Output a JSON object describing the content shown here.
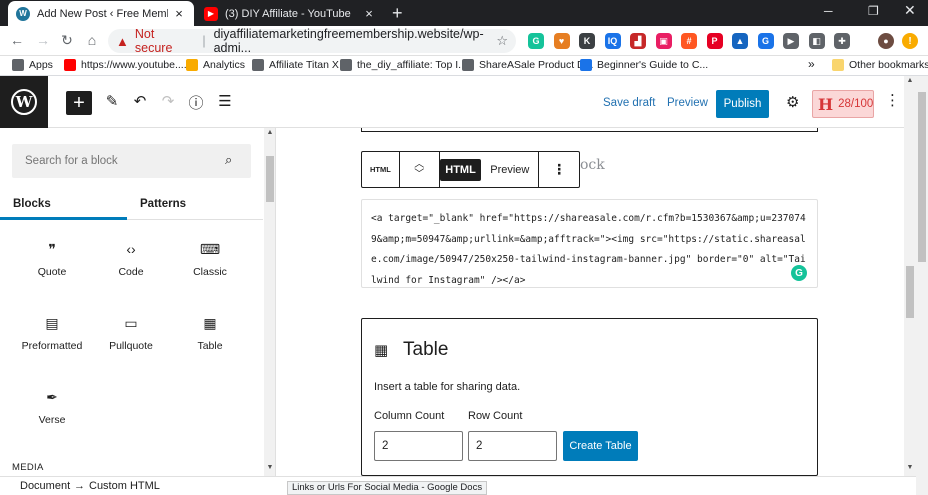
{
  "browser": {
    "tabs": [
      {
        "title": "Add New Post ‹ Free Membership F",
        "active": true
      },
      {
        "title": "(3) DIY Affiliate - YouTube",
        "active": false
      }
    ],
    "security_label": "Not secure",
    "url": "diyaffiliatemarketingfreemembership.website/wp-admi...",
    "extensions": [
      {
        "name": "grammarly-icon",
        "glyph": "G",
        "color": "#15c39a"
      },
      {
        "name": "heart-icon",
        "glyph": "♥",
        "color": "#e67e22"
      },
      {
        "name": "k-extension-icon",
        "glyph": "K",
        "color": "#3c4043"
      },
      {
        "name": "iq-extension-icon",
        "glyph": "IQ",
        "color": "#1a73e8"
      },
      {
        "name": "chart-extension-icon",
        "glyph": "▟",
        "color": "#c62828"
      },
      {
        "name": "photo-extension-icon",
        "glyph": "▣",
        "color": "#e91e63"
      },
      {
        "name": "hashtag-extension-icon",
        "glyph": "#",
        "color": "#ff5722"
      },
      {
        "name": "pinterest-icon",
        "glyph": "P",
        "color": "#e60023"
      },
      {
        "name": "tailwind-icon",
        "glyph": "▲",
        "color": "#1565c0"
      },
      {
        "name": "translate-icon",
        "glyph": "G",
        "color": "#1a73e8"
      },
      {
        "name": "video-extension-icon",
        "glyph": "▶",
        "color": "#5f6368"
      },
      {
        "name": "screenshot-extension-icon",
        "glyph": "◧",
        "color": "#5f6368"
      },
      {
        "name": "puzzle-icon",
        "glyph": "✚",
        "color": "#5f6368"
      }
    ],
    "bookmarks": [
      {
        "label": "Apps",
        "icon": "apps-grid-icon",
        "color": "#5f6368"
      },
      {
        "label": "https://www.youtube....",
        "icon": "youtube-icon",
        "color": "#ff0000"
      },
      {
        "label": "Analytics",
        "icon": "analytics-icon",
        "color": "#f9ab00"
      },
      {
        "label": "Affiliate Titan X",
        "icon": "globe-icon",
        "color": "#5f6368"
      },
      {
        "label": "the_diy_affiliate: Top I...",
        "icon": "globe-icon",
        "color": "#5f6368"
      },
      {
        "label": "ShareASale Product D...",
        "icon": "globe-icon",
        "color": "#5f6368"
      },
      {
        "label": "Beginner's Guide to C...",
        "icon": "sb-icon",
        "color": "#1a73e8"
      }
    ],
    "bookmarks_more": "»",
    "other_bookmarks": "Other bookmarks"
  },
  "wp": {
    "header": {
      "save_draft": "Save draft",
      "preview": "Preview",
      "publish": "Publish",
      "seo_score": "28/100",
      "seo_letter": "H"
    },
    "inserter": {
      "search_placeholder": "Search for a block",
      "tabs": [
        "Blocks",
        "Patterns"
      ],
      "blocks": [
        {
          "label": "Quote",
          "icon": "quote-icon",
          "glyph": "❞"
        },
        {
          "label": "Code",
          "icon": "code-icon",
          "glyph": "‹›"
        },
        {
          "label": "Classic",
          "icon": "keyboard-icon",
          "glyph": "⌨"
        },
        {
          "label": "Preformatted",
          "icon": "preformatted-icon",
          "glyph": "▤"
        },
        {
          "label": "Pullquote",
          "icon": "pullquote-icon",
          "glyph": "▭"
        },
        {
          "label": "Table",
          "icon": "table-icon",
          "glyph": "▦"
        },
        {
          "label": "Verse",
          "icon": "feather-icon",
          "glyph": "✒"
        }
      ],
      "section_media": "MEDIA"
    },
    "block_toolbar": {
      "html_small": "HTML",
      "html_tab": "HTML",
      "preview_tab": "Preview"
    },
    "behind_text": "ock",
    "code": "<a target=\"_blank\" href=\"https://shareasale.com/r.cfm?b=1530367&amp;u=2370749&amp;m=50947&amp;urllink=&amp;afftrack=\"><img src=\"https://static.shareasale.com/image/50947/250x250-tailwind-instagram-banner.jpg\" border=\"0\" alt=\"Tailwind for Instagram\" /></a>",
    "table_block": {
      "title": "Table",
      "description": "Insert a table for sharing data.",
      "column_label": "Column Count",
      "row_label": "Row Count",
      "column_value": "2",
      "row_value": "2",
      "create_button": "Create Table"
    },
    "footer": {
      "breadcrumb": [
        "Document",
        "Custom HTML"
      ],
      "separator": "→"
    }
  },
  "status_tooltip": "Links or Urls For Social Media - Google Docs"
}
